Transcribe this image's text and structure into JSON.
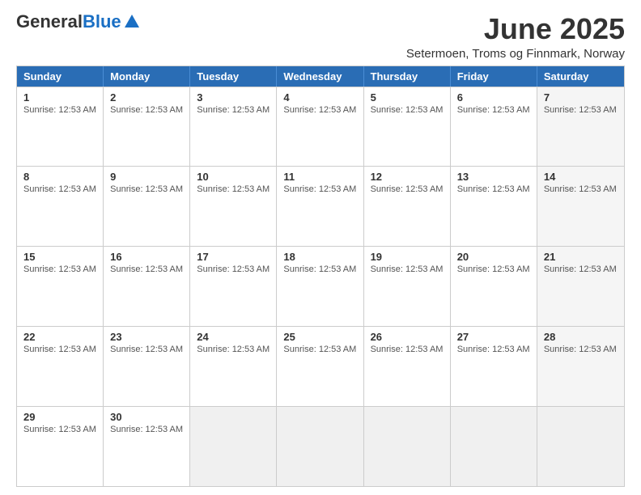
{
  "header": {
    "logo_general": "General",
    "logo_blue": "Blue",
    "month_year": "June 2025",
    "location": "Setermoen, Troms og Finnmark, Norway"
  },
  "calendar": {
    "days_of_week": [
      "Sunday",
      "Monday",
      "Tuesday",
      "Wednesday",
      "Thursday",
      "Friday",
      "Saturday"
    ],
    "sunrise_label": "Sunrise:",
    "sunrise_time": "12:53 AM",
    "weeks": [
      {
        "days": [
          {
            "num": "1",
            "empty": false
          },
          {
            "num": "2",
            "empty": false
          },
          {
            "num": "3",
            "empty": false
          },
          {
            "num": "4",
            "empty": false
          },
          {
            "num": "5",
            "empty": false
          },
          {
            "num": "6",
            "empty": false
          },
          {
            "num": "7",
            "empty": false
          }
        ]
      },
      {
        "days": [
          {
            "num": "8",
            "empty": false
          },
          {
            "num": "9",
            "empty": false
          },
          {
            "num": "10",
            "empty": false
          },
          {
            "num": "11",
            "empty": false
          },
          {
            "num": "12",
            "empty": false
          },
          {
            "num": "13",
            "empty": false
          },
          {
            "num": "14",
            "empty": false
          }
        ]
      },
      {
        "days": [
          {
            "num": "15",
            "empty": false
          },
          {
            "num": "16",
            "empty": false
          },
          {
            "num": "17",
            "empty": false
          },
          {
            "num": "18",
            "empty": false
          },
          {
            "num": "19",
            "empty": false
          },
          {
            "num": "20",
            "empty": false
          },
          {
            "num": "21",
            "empty": false
          }
        ]
      },
      {
        "days": [
          {
            "num": "22",
            "empty": false
          },
          {
            "num": "23",
            "empty": false
          },
          {
            "num": "24",
            "empty": false
          },
          {
            "num": "25",
            "empty": false
          },
          {
            "num": "26",
            "empty": false
          },
          {
            "num": "27",
            "empty": false
          },
          {
            "num": "28",
            "empty": false
          }
        ]
      },
      {
        "days": [
          {
            "num": "29",
            "empty": false
          },
          {
            "num": "30",
            "empty": false
          },
          {
            "num": "",
            "empty": true
          },
          {
            "num": "",
            "empty": true
          },
          {
            "num": "",
            "empty": true
          },
          {
            "num": "",
            "empty": true
          },
          {
            "num": "",
            "empty": true
          }
        ]
      }
    ]
  }
}
